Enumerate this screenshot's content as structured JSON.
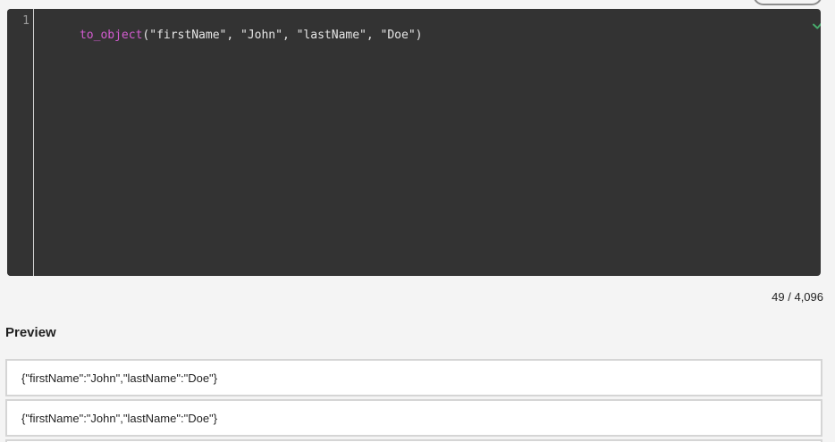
{
  "editor": {
    "line_numbers": [
      "1"
    ],
    "code": {
      "function_name": "to_object",
      "arguments": "(\"firstName\", \"John\", \"lastName\", \"Doe\")"
    },
    "validation_icon": "check-icon",
    "accent_color": "#47a86b"
  },
  "character_count": "49 / 4,096",
  "preview": {
    "title": "Preview",
    "rows": [
      "{\"firstName\":\"John\",\"lastName\":\"Doe\"}",
      "{\"firstName\":\"John\",\"lastName\":\"Doe\"}"
    ]
  }
}
